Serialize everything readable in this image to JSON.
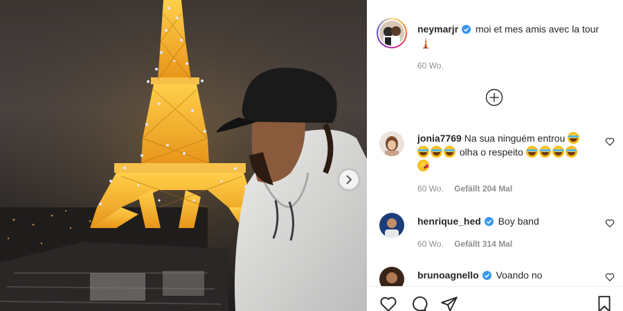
{
  "post": {
    "carousel_next_icon": "chevron-right-icon"
  },
  "caption": {
    "username": "neymarjr",
    "verified": true,
    "text": "moi et mes amis avec la tour",
    "emoji": "tokyo-tower-emoji",
    "time": "60 Wo."
  },
  "load_more_icon": "plus-circle-icon",
  "comments": [
    {
      "username": "jonia7769",
      "verified": false,
      "text_parts": [
        "Na sua ninguém entrou",
        "olha o respeito"
      ],
      "time": "60 Wo.",
      "likes": "Gefällt 204 Mal"
    },
    {
      "username": "henrique_hed",
      "verified": true,
      "text": "Boy band",
      "time": "60 Wo.",
      "likes": "Gefällt 314 Mal"
    },
    {
      "username": "brunoagnello",
      "verified": true,
      "text": "Voando no"
    }
  ],
  "actions": [
    "heart-icon",
    "comment-icon",
    "share-icon",
    "bookmark-icon"
  ],
  "colors": {
    "text": "#262626",
    "muted": "#8e8e8e",
    "verified": "#3897f0",
    "tower_gold": "#f0a91d",
    "tower_lights": "#c8d4ff"
  }
}
